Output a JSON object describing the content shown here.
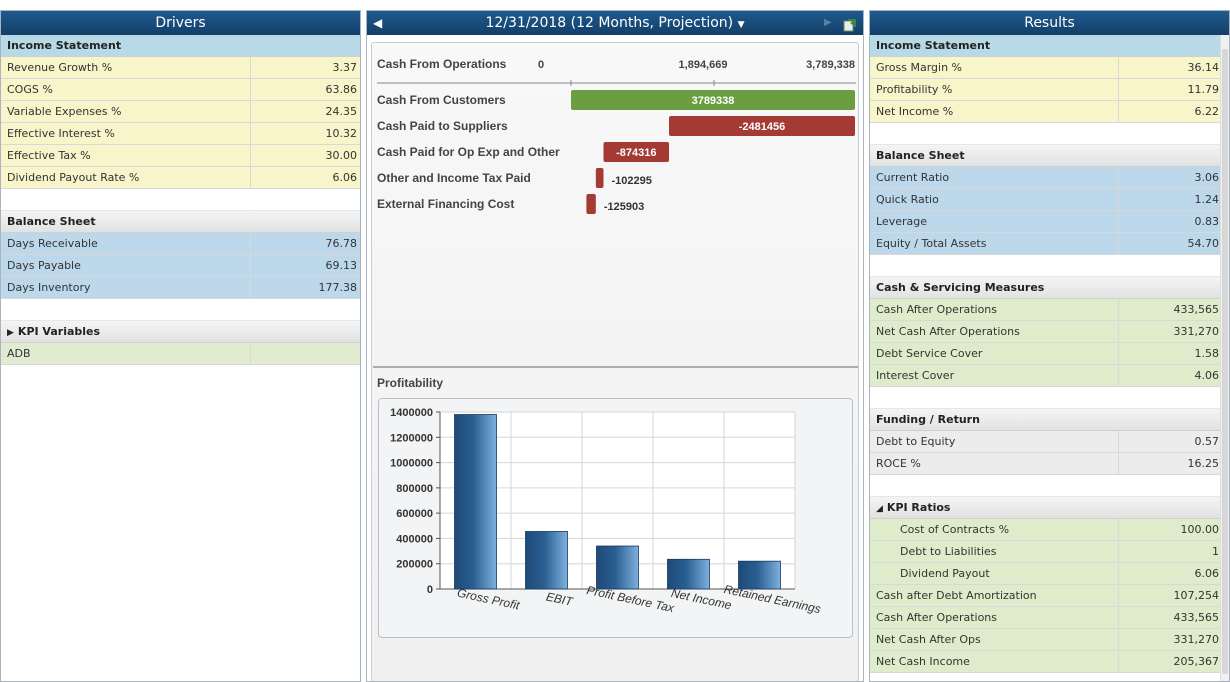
{
  "drivers": {
    "title": "Drivers",
    "income_statement_title": "Income Statement",
    "income_statement": [
      {
        "label": "Revenue Growth %",
        "value": "3.37"
      },
      {
        "label": "COGS %",
        "value": "63.86"
      },
      {
        "label": "Variable Expenses %",
        "value": "24.35"
      },
      {
        "label": "Effective Interest %",
        "value": "10.32"
      },
      {
        "label": "Effective Tax %",
        "value": "30.00"
      },
      {
        "label": "Dividend Payout Rate %",
        "value": "6.06"
      }
    ],
    "balance_sheet_title": "Balance Sheet",
    "balance_sheet": [
      {
        "label": "Days Receivable",
        "value": "76.78"
      },
      {
        "label": "Days Payable",
        "value": "69.13"
      },
      {
        "label": "Days Inventory",
        "value": "177.38"
      }
    ],
    "kpi_title": "KPI Variables",
    "kpi": [
      {
        "label": "ADB",
        "value": ""
      }
    ]
  },
  "center": {
    "period": "12/31/2018 (12 Months, Projection)",
    "cashflow_axis": {
      "label": "Cash From Operations",
      "ticks": [
        "0",
        "1,894,669",
        "3,789,338"
      ]
    },
    "cashflow_items": [
      {
        "label": "Cash From Customers",
        "value": 3789338
      },
      {
        "label": "Cash Paid to Suppliers",
        "value": -2481456
      },
      {
        "label": "Cash Paid for Op Exp and Other",
        "value": -874316
      },
      {
        "label": "Other and Income Tax Paid",
        "value": -102295
      },
      {
        "label": "External Financing Cost",
        "value": -125903
      }
    ],
    "cashflow_colors": {
      "positive": "#6a9e40",
      "negative": "#a33a34"
    },
    "profitability_title": "Profitability",
    "bar_color": "#2a5f92"
  },
  "chart_data": {
    "type": "bar",
    "categories": [
      "Gross Profit",
      "EBIT",
      "Profit Before Tax",
      "Net Income",
      "Retained Earnings"
    ],
    "values": [
      1380000,
      455000,
      340000,
      235000,
      220000
    ],
    "ylim": [
      0,
      1400000
    ],
    "yticks": [
      "0",
      "200000",
      "400000",
      "600000",
      "800000",
      "1000000",
      "1200000",
      "1400000"
    ],
    "grid": true
  },
  "results": {
    "title": "Results",
    "income_statement_title": "Income Statement",
    "income_statement": [
      {
        "label": "Gross Margin %",
        "value": "36.14"
      },
      {
        "label": "Profitability %",
        "value": "11.79"
      },
      {
        "label": "Net Income %",
        "value": "6.22"
      }
    ],
    "balance_sheet_title": "Balance Sheet",
    "balance_sheet": [
      {
        "label": "Current Ratio",
        "value": "3.06"
      },
      {
        "label": "Quick Ratio",
        "value": "1.24"
      },
      {
        "label": "Leverage",
        "value": "0.83"
      },
      {
        "label": "Equity / Total Assets",
        "value": "54.70"
      }
    ],
    "cash_title": "Cash & Servicing Measures",
    "cash": [
      {
        "label": "Cash After Operations",
        "value": "433,565"
      },
      {
        "label": "Net Cash After Operations",
        "value": "331,270"
      },
      {
        "label": "Debt Service Cover",
        "value": "1.58"
      },
      {
        "label": "Interest Cover",
        "value": "4.06"
      }
    ],
    "funding_title": "Funding / Return",
    "funding": [
      {
        "label": "Debt to Equity",
        "value": "0.57"
      },
      {
        "label": "ROCE %",
        "value": "16.25"
      }
    ],
    "kpi_title": "KPI Ratios",
    "kpi_indented": [
      {
        "label": "Cost of Contracts %",
        "value": "100.00"
      },
      {
        "label": "Debt to Liabilities",
        "value": "1"
      },
      {
        "label": "Dividend Payout",
        "value": "6.06"
      }
    ],
    "kpi": [
      {
        "label": "Cash after Debt Amortization",
        "value": "107,254"
      },
      {
        "label": "Cash After Operations",
        "value": "433,565"
      },
      {
        "label": "Net Cash After Ops",
        "value": "331,270"
      },
      {
        "label": "Net Cash Income",
        "value": "205,367"
      }
    ]
  }
}
